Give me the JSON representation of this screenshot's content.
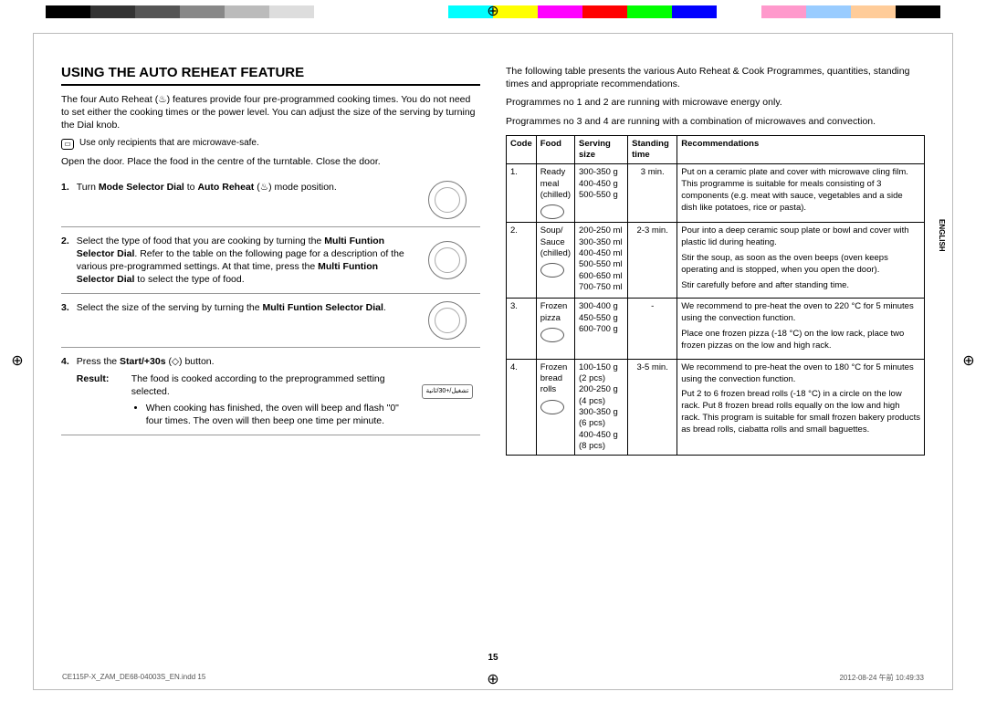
{
  "colorbar": [
    "#000",
    "#333",
    "#555",
    "#888",
    "#bbb",
    "#ddd",
    "#fff",
    "#fff",
    "#fff",
    "#0ff",
    "#ff0",
    "#f0f",
    "#f00",
    "#0f0",
    "#00f",
    "#fff",
    "#f9c",
    "#9cf",
    "#fc9",
    "#000"
  ],
  "side_label": "ENGLISH",
  "heading": "USING THE AUTO REHEAT FEATURE",
  "intro": "The four Auto Reheat (♨) features provide four pre-programmed cooking times. You do not need to set either the cooking times or the power level. You can adjust the size of the serving by turning the Dial knob.",
  "safe_note": "Use only recipients that are microwave-safe.",
  "open_door": "Open the door. Place the food in the centre of the turntable. Close the door.",
  "steps": [
    {
      "num": "1.",
      "html": "Turn <b>Mode Selector Dial</b> to <b>Auto Reheat</b> (♨) mode position.",
      "fig": "dial-complex"
    },
    {
      "num": "2.",
      "html": "Select the type of food that you are cooking by turning the <b>Multi Funtion Selector Dial</b>. Refer to the table on the following page for a description of the various pre-programmed settings. At that time, press the <b>Multi Funtion Selector Dial</b> to select the type of food.",
      "fig": "dial"
    },
    {
      "num": "3.",
      "html": "Select the size of the serving by turning the <b>Multi Funtion Selector Dial</b>.",
      "fig": "dial"
    },
    {
      "num": "4.",
      "html": "Press the <b>Start/+30s</b> (◇) button.",
      "fig": "button"
    }
  ],
  "result_label": "Result:",
  "result_text": "The food is cooked according to the preprogrammed setting selected.",
  "result_bullet": "When cooking has finished, the oven will beep and flash \"0\" four times. The oven will then beep one time per minute.",
  "right_intro1": "The following table presents the various Auto Reheat & Cook Programmes, quantities, standing times and appropriate recommendations.",
  "right_intro2": "Programmes no 1 and 2 are running with microwave energy only.",
  "right_intro3": "Programmes no 3 and 4 are running with a combination of microwaves and convection.",
  "table": {
    "headers": [
      "Code",
      "Food",
      "Serving size",
      "Standing time",
      "Recommendations"
    ],
    "rows": [
      {
        "code": "1.",
        "food": "Ready meal (chilled)",
        "serving": [
          "300-350 g",
          "400-450 g",
          "500-550 g"
        ],
        "standing": "3 min.",
        "reco": [
          "Put on a ceramic plate and cover with microwave cling film. This programme is suitable for meals consisting of 3 components (e.g. meat with sauce, vegetables and a side dish like potatoes, rice or pasta)."
        ]
      },
      {
        "code": "2.",
        "food": "Soup/ Sauce (chilled)",
        "serving": [
          "200-250 ml",
          "300-350 ml",
          "400-450 ml",
          "500-550 ml",
          "600-650 ml",
          "700-750 ml"
        ],
        "standing": "2-3 min.",
        "reco": [
          "Pour into a deep ceramic soup plate or bowl and cover with plastic lid during heating.",
          "Stir the soup, as soon as the oven beeps (oven keeps operating and is stopped, when you open the door).",
          "Stir carefully before and after standing time."
        ]
      },
      {
        "code": "3.",
        "food": "Frozen pizza",
        "serving": [
          "300-400 g",
          "450-550 g",
          "600-700 g"
        ],
        "standing": "-",
        "reco": [
          "We recommend to pre-heat the oven to 220 °C for 5 minutes using the convection function.",
          "Place one frozen pizza (-18 °C) on the low rack, place two frozen pizzas on the low and high rack."
        ]
      },
      {
        "code": "4.",
        "food": "Frozen bread rolls",
        "serving": [
          "100-150 g",
          "(2 pcs)",
          "200-250 g",
          "(4 pcs)",
          "300-350 g",
          "(6 pcs)",
          "400-450 g",
          "(8 pcs)"
        ],
        "standing": "3-5 min.",
        "reco": [
          "We recommend to pre-heat the oven to 180 °C for 5 minutes using the convection function.",
          "Put 2 to 6 frozen bread rolls (-18 °C) in a circle on the low rack. Put 8 frozen bread rolls equally on the low and high rack. This program is suitable for small frozen bakery products as bread rolls, ciabatta rolls and small baguettes."
        ]
      }
    ]
  },
  "page_num": "15",
  "footer_left": "CE115P-X_ZAM_DE68-04003S_EN.indd   15",
  "footer_right": "2012-08-24   午前 10:49:33",
  "btn_label": "تشغيل/+30/ثانية"
}
